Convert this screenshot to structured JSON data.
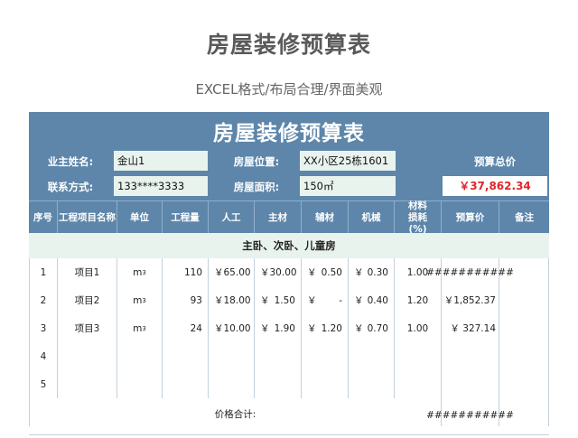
{
  "page": {
    "title": "房屋装修预算表",
    "subtitle": "EXCEL格式/布局合理/界面美观"
  },
  "sheet": {
    "title": "房屋装修预算表",
    "owner_label": "业主姓名:",
    "owner_value": "金山1",
    "location_label": "房屋位置:",
    "location_value": "XX小区25栋1601",
    "budget_label": "预算总价",
    "budget_value": "￥37,862.34",
    "contact_label": "联系方式:",
    "contact_value": "133****3333",
    "area_label": "房屋面积:",
    "area_value": "150㎡"
  },
  "table": {
    "headers": [
      "序号",
      "工程项目名称",
      "单位",
      "工程量",
      "人工",
      "主材",
      "辅材",
      "机械",
      "材料损耗(%)",
      "预算价",
      "备注"
    ],
    "section": "主卧、次卧、儿童房",
    "rows": [
      {
        "no": "1",
        "name": "项目1",
        "unit": "m",
        "unit_sup": "3",
        "qty": "110",
        "labor_cur": "￥",
        "labor": "65.00",
        "main_cur": "￥",
        "main": "30.00",
        "aux_cur": "￥",
        "aux": "0.50",
        "mech_cur": "￥",
        "mech": "0.30",
        "loss": "1.00",
        "budget": "###########",
        "note": ""
      },
      {
        "no": "2",
        "name": "项目2",
        "unit": "m",
        "unit_sup": "3",
        "qty": "93",
        "labor_cur": "￥",
        "labor": "18.00",
        "main_cur": "￥",
        "main": "1.50",
        "aux_cur": "￥",
        "aux": "-",
        "mech_cur": "￥",
        "mech": "0.40",
        "loss": "1.20",
        "budget": "￥1,852.37",
        "note": ""
      },
      {
        "no": "3",
        "name": "项目3",
        "unit": "m",
        "unit_sup": "3",
        "qty": "24",
        "labor_cur": "￥",
        "labor": "10.00",
        "main_cur": "￥",
        "main": "1.90",
        "aux_cur": "￥",
        "aux": "1.20",
        "mech_cur": "￥",
        "mech": "0.70",
        "loss": "1.00",
        "budget": "￥ 327.14",
        "note": ""
      },
      {
        "no": "4",
        "name": "",
        "unit": "",
        "unit_sup": "",
        "qty": "",
        "labor_cur": "",
        "labor": "",
        "main_cur": "",
        "main": "",
        "aux_cur": "",
        "aux": "",
        "mech_cur": "",
        "mech": "",
        "loss": "",
        "budget": "",
        "note": ""
      },
      {
        "no": "5",
        "name": "",
        "unit": "",
        "unit_sup": "",
        "qty": "",
        "labor_cur": "",
        "labor": "",
        "main_cur": "",
        "main": "",
        "aux_cur": "",
        "aux": "",
        "mech_cur": "",
        "mech": "",
        "loss": "",
        "budget": "",
        "note": ""
      }
    ],
    "sum_label": "价格合计:",
    "sum_value": "###########"
  },
  "colors": {
    "header_blue": "#5d86aa",
    "light_green": "#e9f3ee",
    "total_red": "#e0262c"
  }
}
